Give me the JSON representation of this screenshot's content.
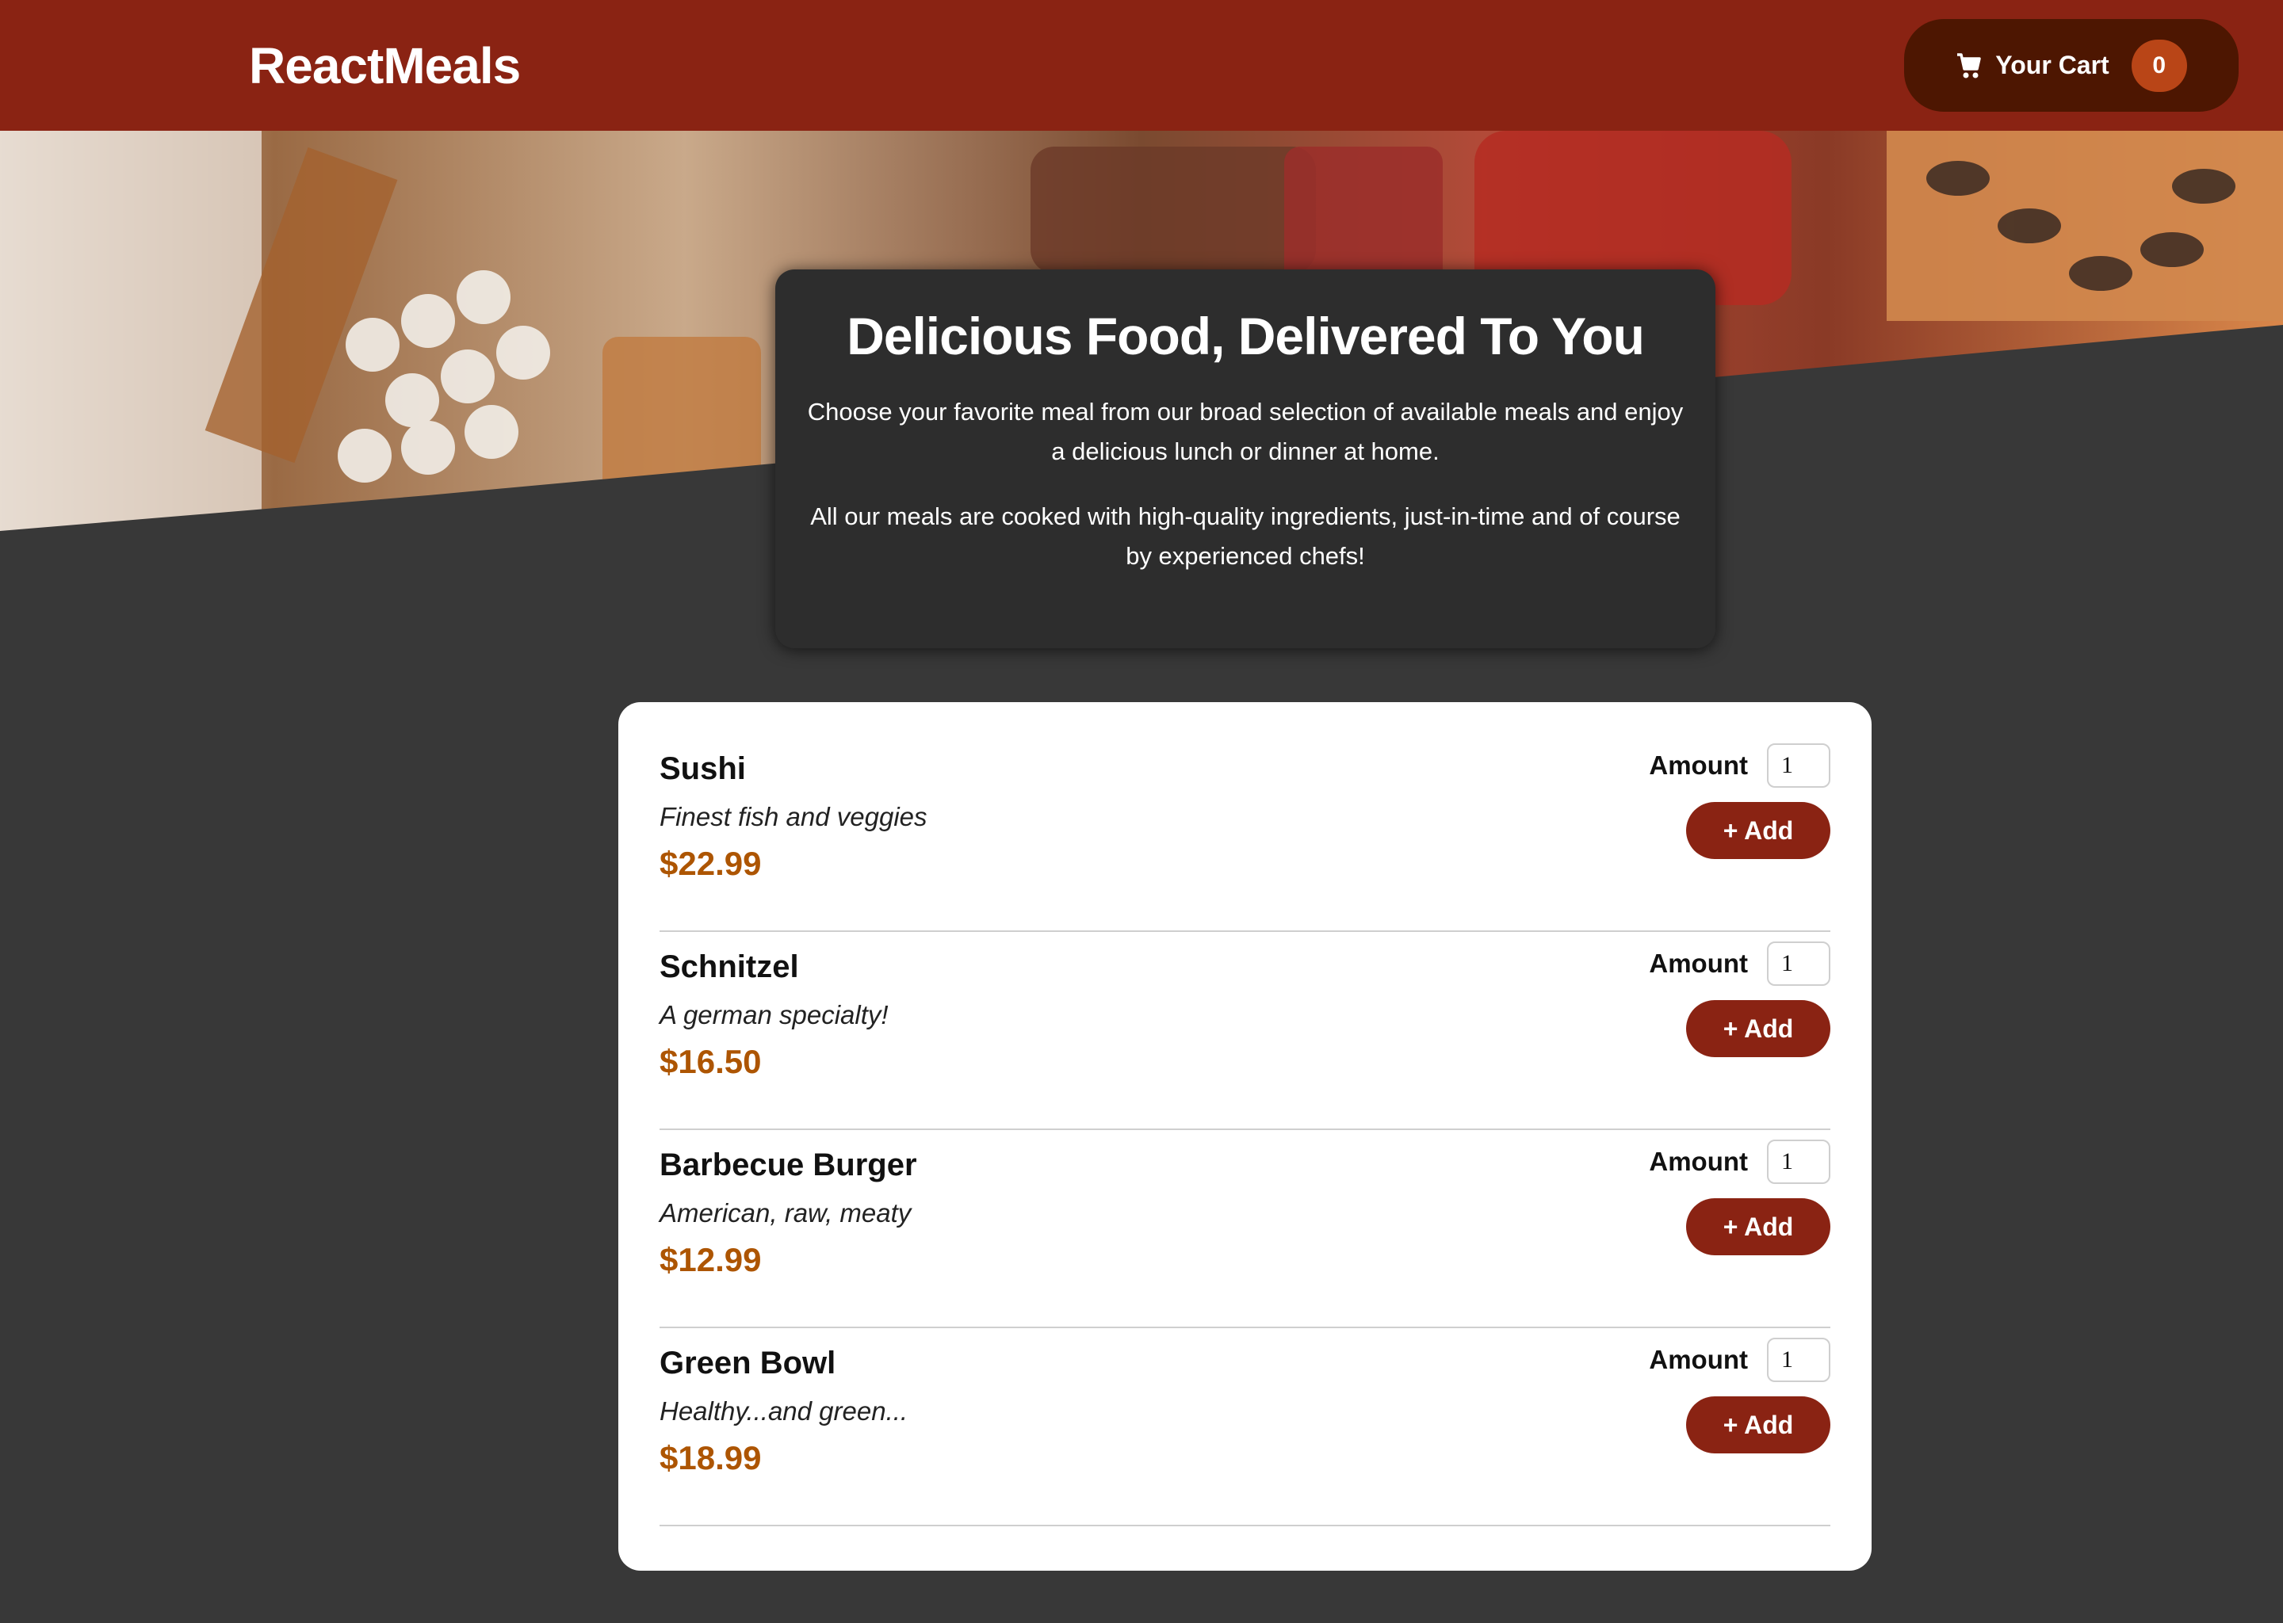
{
  "header": {
    "brand": "ReactMeals",
    "cart": {
      "label": "Your Cart",
      "count": "0"
    }
  },
  "summary": {
    "title": "Delicious Food, Delivered To You",
    "paragraph1": "Choose your favorite meal from our broad selection of available meals and enjoy a delicious lunch or dinner at home.",
    "paragraph2": "All our meals are cooked with high-quality ingredients, just-in-time and of course by experienced chefs!"
  },
  "meals": [
    {
      "name": "Sushi",
      "description": "Finest fish and veggies",
      "price": "$22.99",
      "amount_label": "Amount",
      "amount": "1",
      "add_label": "+ Add"
    },
    {
      "name": "Schnitzel",
      "description": "A german specialty!",
      "price": "$16.50",
      "amount_label": "Amount",
      "amount": "1",
      "add_label": "+ Add"
    },
    {
      "name": "Barbecue Burger",
      "description": "American, raw, meaty",
      "price": "$12.99",
      "amount_label": "Amount",
      "amount": "1",
      "add_label": "+ Add"
    },
    {
      "name": "Green Bowl",
      "description": "Healthy...and green...",
      "price": "$18.99",
      "amount_label": "Amount",
      "amount": "1",
      "add_label": "+ Add"
    }
  ],
  "colors": {
    "header": "#8a2313",
    "cart_button": "#4d1601",
    "cart_badge": "#b94517",
    "price": "#ad5502",
    "background": "#383838"
  },
  "icons": {
    "cart": "shopping-cart-icon"
  }
}
